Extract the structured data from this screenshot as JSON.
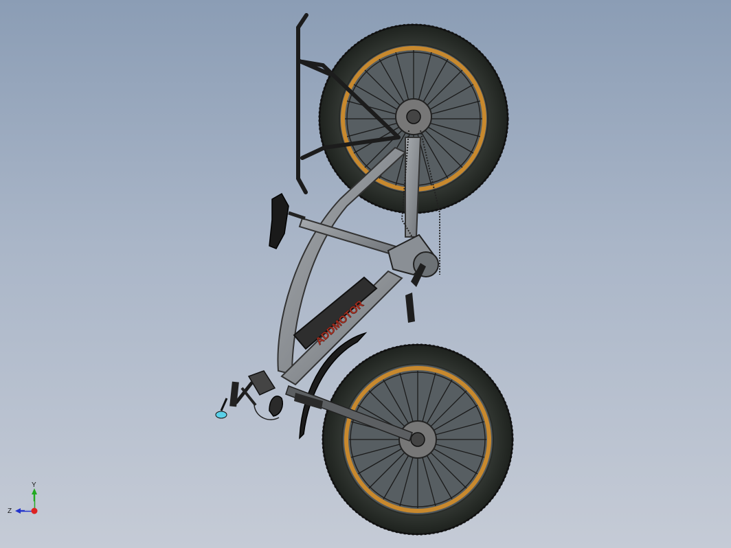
{
  "model": {
    "brand_text": "ADDMOTOR",
    "description_icon": "bicycle-model-icon"
  },
  "triad": {
    "y_label": "Y",
    "z_label": "Z"
  },
  "colors": {
    "background_top": "#8b9db5",
    "background_bottom": "#c5cbd6",
    "frame": "#8a8f95",
    "rim": "#c8892e",
    "tire": "#2b2f2b",
    "brand_text": "#b03020",
    "axis_y": "#22aa22",
    "axis_z": "#2233cc",
    "axis_origin": "#dd2222"
  }
}
